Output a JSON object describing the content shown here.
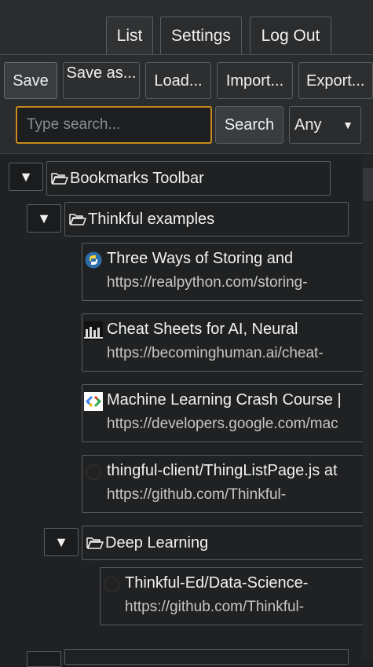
{
  "tabs": [
    {
      "label": "List",
      "active": true
    },
    {
      "label": "Settings",
      "active": false
    },
    {
      "label": "Log Out",
      "active": false
    }
  ],
  "toolbar": {
    "save": "Save",
    "save_as": "Save as...",
    "load": "Load...",
    "import": "Import...",
    "export": "Export..."
  },
  "search": {
    "placeholder": "Type search...",
    "value": "",
    "button": "Search",
    "filter_selected": "Any"
  },
  "tree": {
    "toggle_glyph": "▼",
    "root": {
      "label": "Bookmarks Toolbar",
      "children": {
        "thinkful": {
          "label": "Thinkful examples",
          "bookmarks": [
            {
              "title": "Three Ways of Storing and",
              "url": "https://realpython.com/storing-",
              "icon": "python-icon"
            },
            {
              "title": "Cheat Sheets for AI, Neural",
              "url": "https://becominghuman.ai/cheat-",
              "icon": "becominghuman-icon"
            },
            {
              "title": "Machine Learning Crash Course  |",
              "url": "https://developers.google.com/mac",
              "icon": "google-developers-icon"
            },
            {
              "title": "thingful-client/ThingListPage.js at",
              "url": "https://github.com/Thinkful-",
              "icon": "github-icon"
            }
          ],
          "deep_learning": {
            "label": "Deep Learning",
            "bookmarks": [
              {
                "title": "Thinkful-Ed/Data-Science-",
                "url": "https://github.com/Thinkful-",
                "icon": "github-icon"
              }
            ]
          }
        }
      }
    }
  },
  "colors": {
    "accent_focus": "#c98a1e",
    "background": "#1f2123",
    "border": "#5a5c5e"
  }
}
